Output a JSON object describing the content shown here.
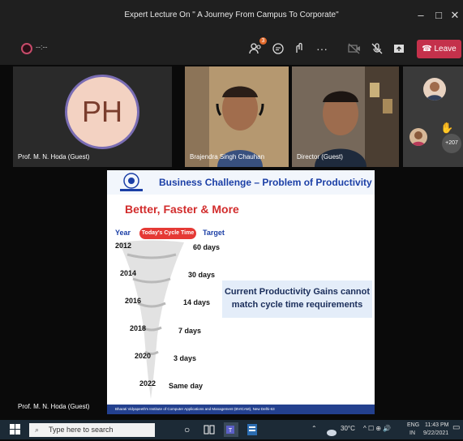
{
  "window": {
    "title": "Expert Lecture On \" A Journey From Campus To Corporate\"",
    "minimize_glyph": "–",
    "maximize_glyph": "□",
    "close_glyph": "✕"
  },
  "toolbar": {
    "timer": "--:--",
    "participants_badge": "3",
    "more_glyph": "···",
    "leave_label": "Leave",
    "icons": [
      "participants-icon",
      "chat-icon",
      "reactions-icon",
      "more-icon",
      "camera-off-icon",
      "mic-off-icon",
      "share-icon",
      "phone-icon"
    ]
  },
  "participants": [
    {
      "initials": "PH",
      "name": "Prof. M. N. Hoda (Guest)"
    },
    {
      "name": "Brajendra Singh Chauhan"
    },
    {
      "name": "Director (Guest)"
    }
  ],
  "overflow": {
    "count": "+207"
  },
  "slide": {
    "title": "Business Challenge – Problem of Productivity",
    "subtitle": "Better, Faster & More",
    "year_label": "Year",
    "cycle_label": "Today's Cycle Time",
    "target_label": "Target",
    "rows": [
      {
        "year": "2012",
        "days": "60 days"
      },
      {
        "year": "2014",
        "days": "30 days"
      },
      {
        "year": "2016",
        "days": "14 days"
      },
      {
        "year": "2018",
        "days": "7 days"
      },
      {
        "year": "2020",
        "days": "3 days"
      },
      {
        "year": "2022",
        "days": "Same day"
      }
    ],
    "callout": "Current Productivity Gains cannot match cycle time requirements",
    "footer": "Bharati Vidyapeeth's Institute of Computer Applications and Management (BVICAM), New Delhi-63"
  },
  "presenter_name": "Prof. M. N. Hoda (Guest)",
  "taskbar": {
    "search_placeholder": "Type here to search",
    "temperature": "30°C",
    "lang": "ENG",
    "region": "IN",
    "time": "11:43 PM",
    "date": "9/22/2021"
  }
}
